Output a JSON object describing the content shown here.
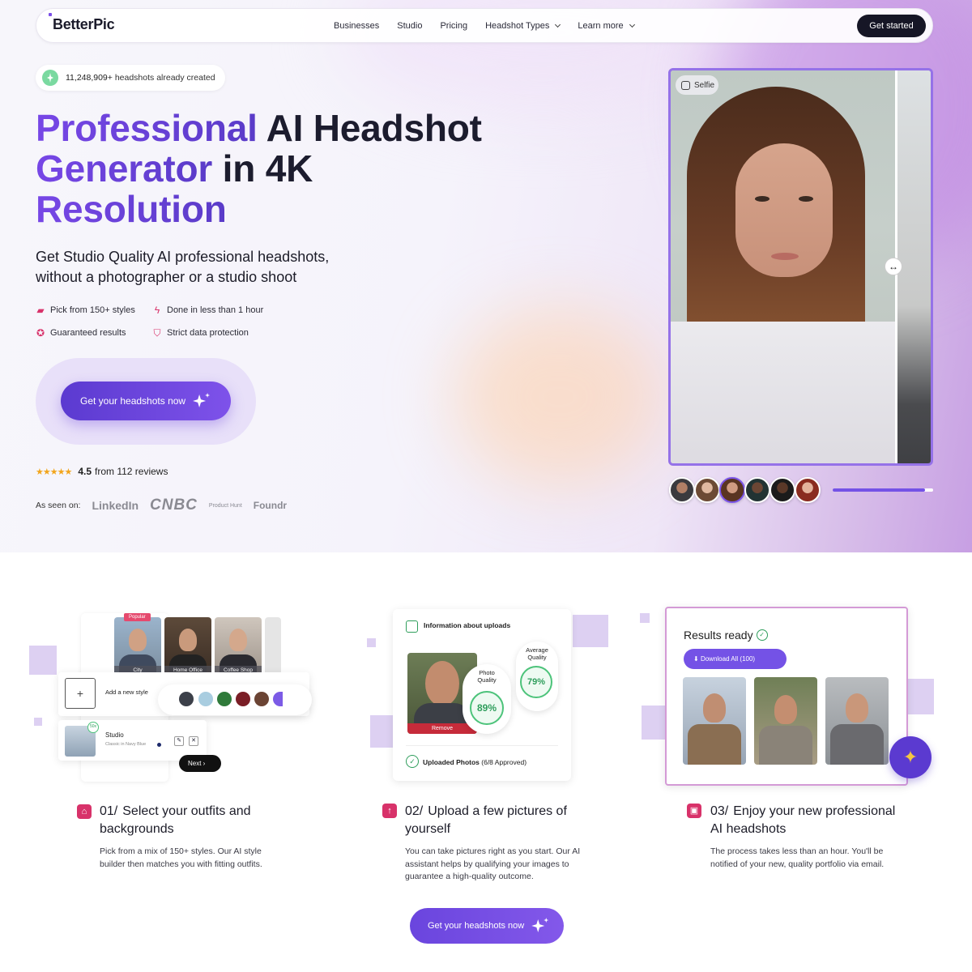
{
  "nav": {
    "logo": "BetterPic",
    "links": [
      "Businesses",
      "Studio",
      "Pricing",
      "Headshot Types",
      "Learn more"
    ],
    "cta": "Get started"
  },
  "hero": {
    "badge_count": "11,248,909+",
    "badge_text": "headshots already created",
    "title_line1_accent": "Professional",
    "title_line1_rest": "AI Headshot",
    "title_line2_accent": "Generator",
    "title_line2_rest": "in 4K",
    "title_line3_accent": "Resolution",
    "subtitle": "Get Studio Quality AI professional headshots, without a photographer or a studio shoot",
    "features": [
      "Pick from 150+ styles",
      "Done in less than 1 hour",
      "Guaranteed results",
      "Strict data protection"
    ],
    "cta": "Get your headshots now",
    "rating_value": "4.5",
    "rating_text": "from 112 reviews",
    "stars": 4.5,
    "seen_label": "As seen on:",
    "seen_logos": [
      "LinkedIn",
      "CNBC",
      "Product Hunt",
      "Foundr"
    ],
    "selfie_tag": "Selfie",
    "carousel_progress": 0.92
  },
  "steps": [
    {
      "num": "01/",
      "title": "Select your outfits and backgrounds",
      "desc": "Pick from a mix of 150+ styles. Our AI style builder then matches you with fitting outfits.",
      "tiles": [
        "City",
        "Home Office",
        "Coffee Shop"
      ],
      "popular": "Popular",
      "add_style": "Add a new style",
      "studio_name": "Studio",
      "studio_sub": "Classic in Navy Blue",
      "studio_badge": "50x",
      "next": "Next",
      "swatch_colors": [
        "#3c4049",
        "#a9cde0",
        "#2f7a3a",
        "#7a1e26",
        "#6b4434",
        "#7c5be6"
      ]
    },
    {
      "num": "02/",
      "title": "Upload a few pictures of yourself",
      "desc": "You can take pictures right as you start. Our AI assistant helps by qualifying your images to guarantee a high-quality outcome.",
      "card_title": "Information about uploads",
      "photo_quality_label": "Photo Quality",
      "photo_quality": "89%",
      "avg_quality_label": "Average Quality",
      "avg_quality": "79%",
      "remove": "Remove",
      "uploaded_label": "Uploaded Photos",
      "uploaded_status": "(6/8 Approved)"
    },
    {
      "num": "03/",
      "title": "Enjoy your new professional AI headshots",
      "desc": "The process takes less than an hour. You'll be notified of your new, quality portfolio via email.",
      "card_title": "Results ready",
      "download": "Download All (100)"
    }
  ],
  "cta_bottom": "Get your headshots now",
  "colors": {
    "accent": "#7452e6",
    "pink": "#d8326a",
    "dark": "#161626"
  }
}
